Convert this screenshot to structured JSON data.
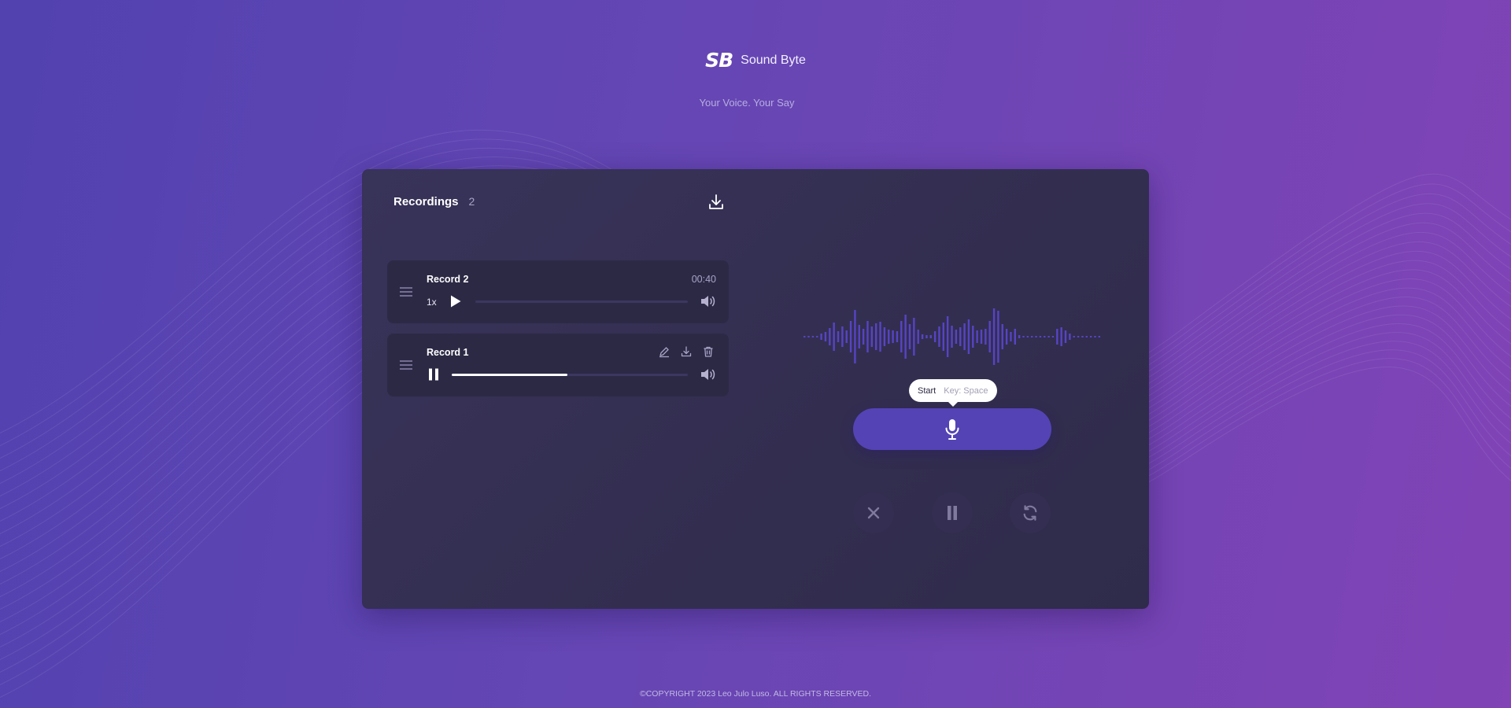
{
  "brand": {
    "logo": "SB",
    "name": "Sound Byte",
    "tagline": "Your Voice. Your Say"
  },
  "recordings": {
    "title": "Recordings",
    "count": "2",
    "items": [
      {
        "name": "Record 2",
        "duration": "00:40",
        "speed": "1x",
        "state": "paused",
        "progress": 0.0
      },
      {
        "name": "Record 1",
        "state": "playing",
        "progress": 0.49
      }
    ]
  },
  "recorder": {
    "tooltip": {
      "action": "Start",
      "key": "Key: Space"
    },
    "wave_heights": [
      2,
      2,
      2,
      2,
      8,
      12,
      22,
      36,
      14,
      26,
      16,
      40,
      68,
      30,
      20,
      40,
      26,
      34,
      38,
      24,
      18,
      16,
      14,
      40,
      56,
      32,
      48,
      18,
      6,
      4,
      4,
      14,
      26,
      36,
      52,
      28,
      18,
      24,
      34,
      44,
      28,
      16,
      18,
      20,
      40,
      72,
      66,
      32,
      20,
      12,
      20,
      4,
      2,
      2,
      2,
      2,
      2,
      2,
      2,
      2,
      20,
      24,
      16,
      8,
      2,
      2,
      2,
      2,
      2,
      2,
      2
    ],
    "accent_color": "#5443b5",
    "wave_color": "#5644c3"
  },
  "icons": [
    "download-icon",
    "drag-handle-icon",
    "play-icon",
    "pause-icon",
    "volume-icon",
    "edit-icon",
    "trash-icon",
    "microphone-icon",
    "close-icon",
    "refresh-icon"
  ],
  "footer": {
    "copyright": "©COPYRIGHT 2023 Leo Julo Luso. ALL RIGHTS RESERVED."
  }
}
